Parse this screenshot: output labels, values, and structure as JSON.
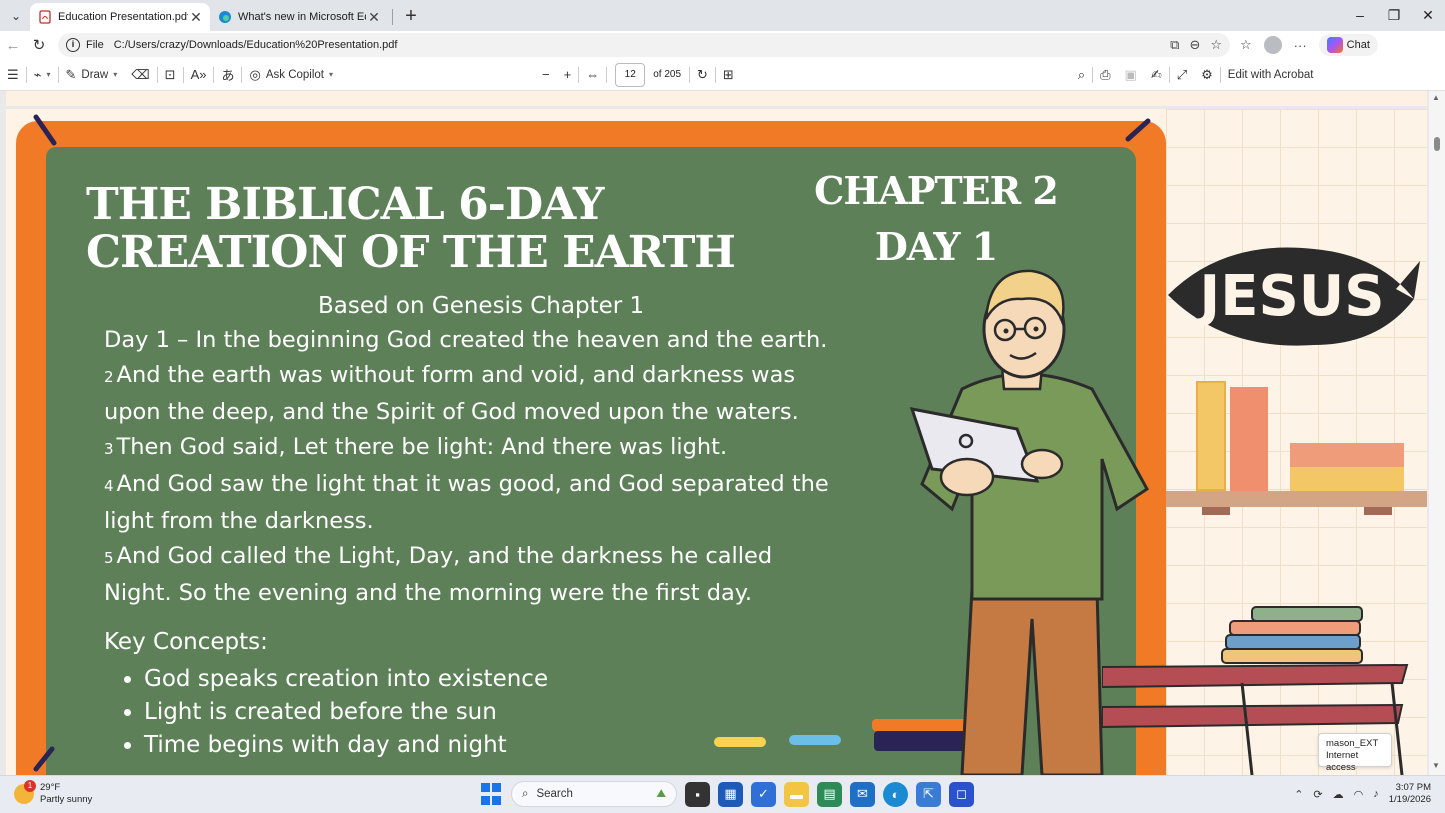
{
  "browser": {
    "tabs": [
      {
        "title": "Education Presentation.pdf",
        "active": true
      },
      {
        "title": "What's new in Microsoft Edge",
        "active": false
      }
    ],
    "address": {
      "scheme": "File",
      "url": "C:/Users/crazy/Downloads/Education%20Presentation.pdf"
    },
    "chat_label": "Chat"
  },
  "pdf_toolbar": {
    "draw_label": "Draw",
    "ask_copilot_label": "Ask Copilot",
    "page_current": "12",
    "page_total_label": "of 205",
    "edit_acrobat_label": "Edit with Acrobat"
  },
  "slide": {
    "title": "THE BIBLICAL 6-DAY CREATION OF THE EARTH",
    "chapter_line1": "CHAPTER 2",
    "chapter_line2": "DAY 1",
    "subtitle": "Based on Genesis Chapter 1",
    "verses": [
      {
        "num": "",
        "text": "Day 1 – In the beginning God created the heaven and the earth."
      },
      {
        "num": "2",
        "text": "And the earth was without form and void, and darkness was upon the deep, and the Spirit of God moved upon the waters."
      },
      {
        "num": "3",
        "text": "Then God said, Let there be light: And there was light."
      },
      {
        "num": "4",
        "text": "And God saw the light that it was good, and God separated the light from the darkness."
      },
      {
        "num": "5",
        "text": "And God called the Light, Day, and the darkness he called Night. So the evening and the morning were the first day."
      }
    ],
    "key_title": "Key Concepts:",
    "key_concepts": [
      "God speaks creation into existence",
      "Light is created before the sun",
      "Time begins with day and night"
    ],
    "fish_text": "JESUS"
  },
  "tooltip": {
    "line1": "mason_EXT",
    "line2": "Internet access"
  },
  "taskbar": {
    "weather_temp": "29°F",
    "weather_desc": "Partly sunny",
    "weather_badge": "1",
    "search_placeholder": "Search",
    "time": "3:07 PM",
    "date": "1/19/2026"
  },
  "colors": {
    "board_green": "#5d8059",
    "frame_orange": "#f07a26",
    "page_cream": "#fdf3e6"
  }
}
